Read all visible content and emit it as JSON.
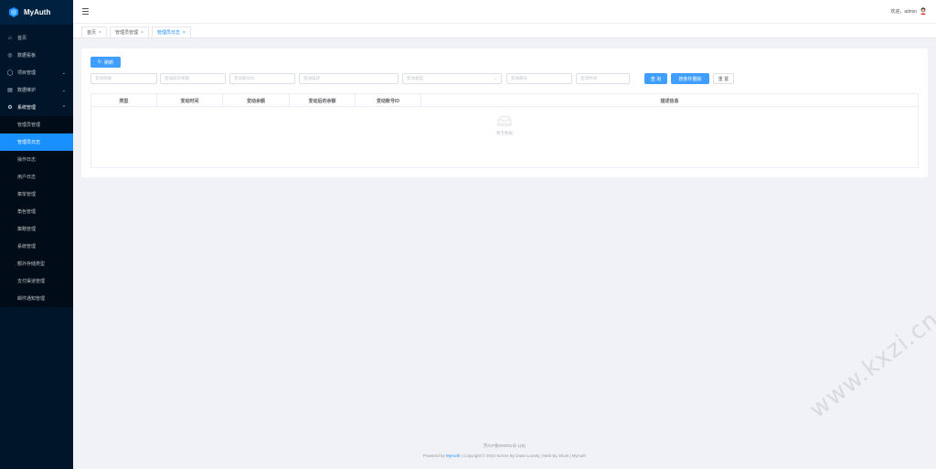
{
  "app": {
    "name": "MyAuth"
  },
  "sidebar": {
    "items": [
      {
        "label": "首页",
        "icon": "home-icon"
      },
      {
        "label": "数据看板",
        "icon": "dashboard-icon"
      },
      {
        "label": "项目管理",
        "icon": "project-icon",
        "has_children": true
      },
      {
        "label": "数据维护",
        "icon": "data-icon",
        "has_children": true
      },
      {
        "label": "系统管理",
        "icon": "settings-icon",
        "has_children": true,
        "open": true
      }
    ],
    "submenu": [
      {
        "label": "管理员管理"
      },
      {
        "label": "管理员日志",
        "active": true
      },
      {
        "label": "操作日志"
      },
      {
        "label": "用户日志"
      },
      {
        "label": "菜单管理"
      },
      {
        "label": "角色管理"
      },
      {
        "label": "策略管理"
      },
      {
        "label": "系统管理"
      },
      {
        "label": "额外存储类型"
      },
      {
        "label": "支付渠道管理"
      },
      {
        "label": "邮件通知管理"
      }
    ]
  },
  "header": {
    "welcome": "欢迎，admin"
  },
  "tabs": [
    {
      "label": "首页"
    },
    {
      "label": "管理员管理"
    },
    {
      "label": "管理员日志",
      "active": true
    }
  ],
  "toolbar": {
    "refresh_label": "刷新"
  },
  "filters": {
    "f1": "变动余额",
    "f2": "变动前的余额",
    "f3": "变动账号ID",
    "f4": "变动描述",
    "f5": "变动类型",
    "f6": "变动账号",
    "f7": "变动时间",
    "search_label": "查 询",
    "delete_label": "按条件删除",
    "reset_label": "重 置"
  },
  "table": {
    "columns": [
      "类型",
      "变动时间",
      "变动余额",
      "变动后的余额",
      "变动账号ID",
      "描述信息"
    ],
    "empty_text": "暂无数据"
  },
  "footer": {
    "icp": "苏ICP备000001号-1(B)",
    "powered_prefix": "Powered by",
    "powered_link": "MyAuth",
    "copyright": "| Copyright © 2022 Server By Dawn.Lonely | Web By Show | MyAuth"
  },
  "watermark": "www.kxzi.cn",
  "colors": {
    "sidebar": "#001529",
    "accent": "#1890ff",
    "primary_button": "#409eff"
  }
}
